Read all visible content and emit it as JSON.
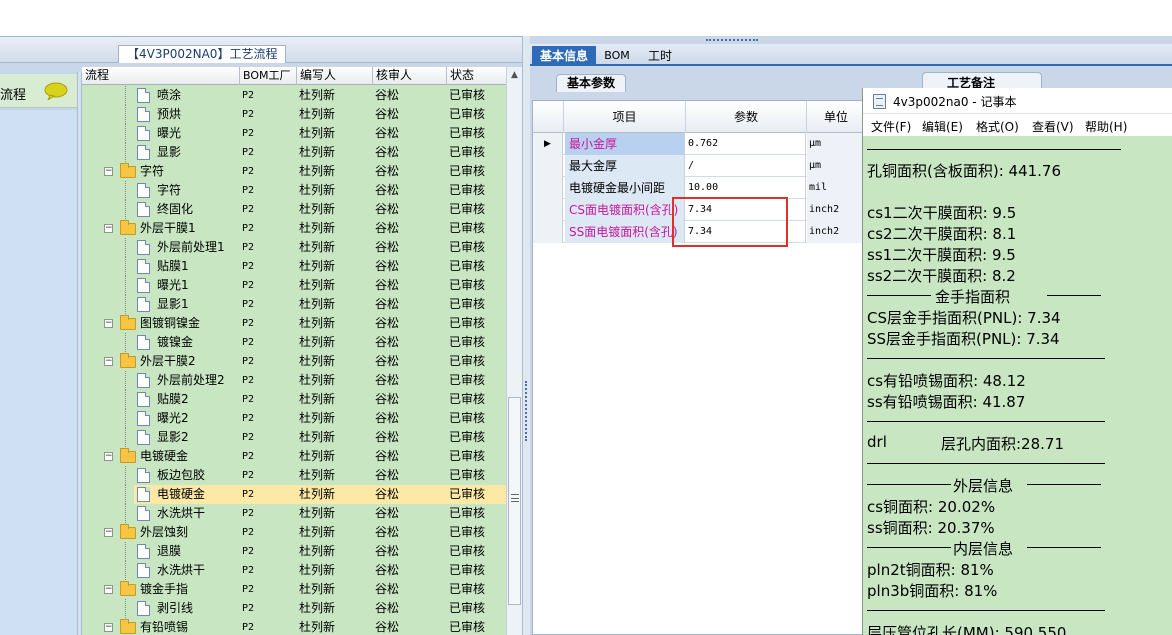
{
  "left_panel": {
    "title": "【4V3P002NA0】工艺流程",
    "nav_item": "流程",
    "columns": [
      "流程",
      "BOM工厂",
      "编写人",
      "核审人",
      "状态"
    ],
    "rows": [
      {
        "name": "喷涂",
        "bom": "P2",
        "author": "杜列新",
        "reviewer": "谷松",
        "status": "已审核",
        "type": "doc",
        "level": 2
      },
      {
        "name": "预烘",
        "bom": "P2",
        "author": "杜列新",
        "reviewer": "谷松",
        "status": "已审核",
        "type": "doc",
        "level": 2
      },
      {
        "name": "曝光",
        "bom": "P2",
        "author": "杜列新",
        "reviewer": "谷松",
        "status": "已审核",
        "type": "doc",
        "level": 2
      },
      {
        "name": "显影",
        "bom": "P2",
        "author": "杜列新",
        "reviewer": "谷松",
        "status": "已审核",
        "type": "doc",
        "level": 2
      },
      {
        "name": "字符",
        "bom": "P2",
        "author": "杜列新",
        "reviewer": "谷松",
        "status": "已审核",
        "type": "folder",
        "level": 1
      },
      {
        "name": "字符",
        "bom": "P2",
        "author": "杜列新",
        "reviewer": "谷松",
        "status": "已审核",
        "type": "doc",
        "level": 2
      },
      {
        "name": "终固化",
        "bom": "P2",
        "author": "杜列新",
        "reviewer": "谷松",
        "status": "已审核",
        "type": "doc",
        "level": 2
      },
      {
        "name": "外层干膜1",
        "bom": "P2",
        "author": "杜列新",
        "reviewer": "谷松",
        "status": "已审核",
        "type": "folder",
        "level": 1
      },
      {
        "name": "外层前处理1",
        "bom": "P2",
        "author": "杜列新",
        "reviewer": "谷松",
        "status": "已审核",
        "type": "doc",
        "level": 2
      },
      {
        "name": "贴膜1",
        "bom": "P2",
        "author": "杜列新",
        "reviewer": "谷松",
        "status": "已审核",
        "type": "doc",
        "level": 2
      },
      {
        "name": "曝光1",
        "bom": "P2",
        "author": "杜列新",
        "reviewer": "谷松",
        "status": "已审核",
        "type": "doc",
        "level": 2
      },
      {
        "name": "显影1",
        "bom": "P2",
        "author": "杜列新",
        "reviewer": "谷松",
        "status": "已审核",
        "type": "doc",
        "level": 2
      },
      {
        "name": "图镀铜镍金",
        "bom": "P2",
        "author": "杜列新",
        "reviewer": "谷松",
        "status": "已审核",
        "type": "folder",
        "level": 1
      },
      {
        "name": "镀镍金",
        "bom": "P2",
        "author": "杜列新",
        "reviewer": "谷松",
        "status": "已审核",
        "type": "doc",
        "level": 2
      },
      {
        "name": "外层干膜2",
        "bom": "P2",
        "author": "杜列新",
        "reviewer": "谷松",
        "status": "已审核",
        "type": "folder",
        "level": 1
      },
      {
        "name": "外层前处理2",
        "bom": "P2",
        "author": "杜列新",
        "reviewer": "谷松",
        "status": "已审核",
        "type": "doc",
        "level": 2
      },
      {
        "name": "贴膜2",
        "bom": "P2",
        "author": "杜列新",
        "reviewer": "谷松",
        "status": "已审核",
        "type": "doc",
        "level": 2
      },
      {
        "name": "曝光2",
        "bom": "P2",
        "author": "杜列新",
        "reviewer": "谷松",
        "status": "已审核",
        "type": "doc",
        "level": 2
      },
      {
        "name": "显影2",
        "bom": "P2",
        "author": "杜列新",
        "reviewer": "谷松",
        "status": "已审核",
        "type": "doc",
        "level": 2
      },
      {
        "name": "电镀硬金",
        "bom": "P2",
        "author": "杜列新",
        "reviewer": "谷松",
        "status": "已审核",
        "type": "folder",
        "level": 1
      },
      {
        "name": "板边包胶",
        "bom": "P2",
        "author": "杜列新",
        "reviewer": "谷松",
        "status": "已审核",
        "type": "doc",
        "level": 2
      },
      {
        "name": "电镀硬金",
        "bom": "P2",
        "author": "杜列新",
        "reviewer": "谷松",
        "status": "已审核",
        "type": "doc",
        "level": 2,
        "selected": true
      },
      {
        "name": "水洗烘干",
        "bom": "P2",
        "author": "杜列新",
        "reviewer": "谷松",
        "status": "已审核",
        "type": "doc",
        "level": 2
      },
      {
        "name": "外层蚀刻",
        "bom": "P2",
        "author": "杜列新",
        "reviewer": "谷松",
        "status": "已审核",
        "type": "folder",
        "level": 1
      },
      {
        "name": "退膜",
        "bom": "P2",
        "author": "杜列新",
        "reviewer": "谷松",
        "status": "已审核",
        "type": "doc",
        "level": 2
      },
      {
        "name": "水洗烘干",
        "bom": "P2",
        "author": "杜列新",
        "reviewer": "谷松",
        "status": "已审核",
        "type": "doc",
        "level": 2
      },
      {
        "name": "镀金手指",
        "bom": "P2",
        "author": "杜列新",
        "reviewer": "谷松",
        "status": "已审核",
        "type": "folder",
        "level": 1
      },
      {
        "name": "剥引线",
        "bom": "P2",
        "author": "杜列新",
        "reviewer": "谷松",
        "status": "已审核",
        "type": "doc",
        "level": 2
      },
      {
        "name": "有铅喷锡",
        "bom": "P2",
        "author": "杜列新",
        "reviewer": "谷松",
        "status": "已审核",
        "type": "folder",
        "level": 1
      }
    ]
  },
  "right_panel": {
    "tabs": [
      "基本信息",
      "BOM",
      "工时"
    ],
    "subtab": "基本参数",
    "subtab_right": "工艺备注",
    "columns": [
      "项目",
      "参数",
      "单位"
    ],
    "rows": [
      {
        "item": "最小金厚",
        "param": "0.762",
        "unit": "μm",
        "highlight": true,
        "active": true
      },
      {
        "item": "最大金厚",
        "param": "/",
        "unit": "μm",
        "highlight": false,
        "active": false
      },
      {
        "item": "电镀硬金最小间距",
        "param": "10.00",
        "unit": "mil",
        "highlight": false,
        "active": false
      },
      {
        "item": "CS面电镀面积(含孔)",
        "param": "7.34",
        "unit": "inch2",
        "highlight": true,
        "active": false
      },
      {
        "item": "SS面电镀面积(含孔)",
        "param": "7.34",
        "unit": "inch2",
        "highlight": true,
        "active": false
      }
    ],
    "colors": {
      "highlight_text": "#c8169b",
      "box_red": "#e0302a",
      "tab_active": "#2d6bb8"
    }
  },
  "notepad": {
    "title": "4v3p002na0 - 记事本",
    "menu": [
      "文件(F)",
      "编辑(E)",
      "格式(O)",
      "查看(V)",
      "帮助(H)"
    ],
    "lines": [
      "孔铜面积(含板面积): 441.76",
      "cs1二次干膜面积: 9.5",
      "cs2二次干膜面积: 8.1",
      "ss1二次干膜面积: 9.5",
      "ss2二次干膜面积: 8.2",
      "金手指面积",
      "CS层金手指面积(PNL): 7.34",
      "SS层金手指面积(PNL): 7.34",
      "cs有铅喷锡面积: 48.12",
      "ss有铅喷锡面积: 41.87",
      "drl",
      "层孔内面积:28.71",
      "外层信息",
      "cs铜面积: 20.02%",
      "ss铜面积: 20.37%",
      "内层信息",
      "pln2t铜面积: 81%",
      "pln3b铜面积: 81%",
      "层压管位孔长(MM): 590.550"
    ]
  }
}
